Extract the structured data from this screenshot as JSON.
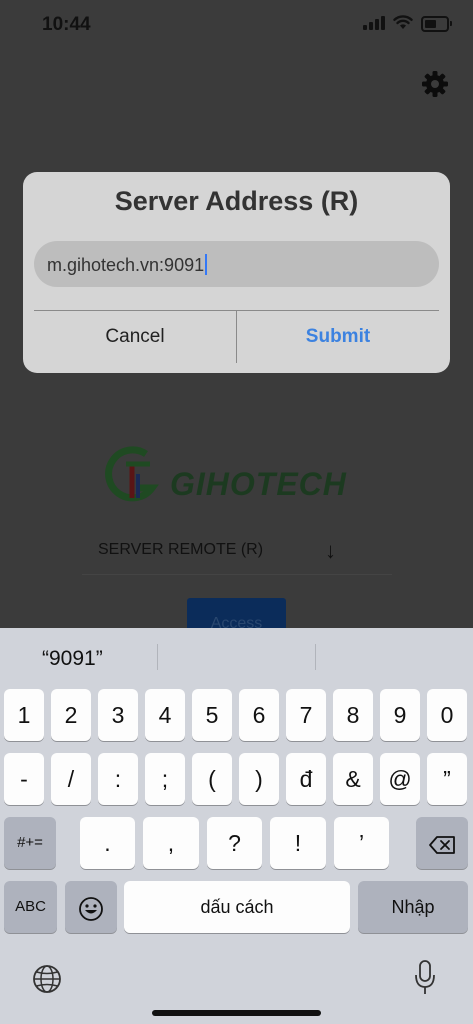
{
  "status_bar": {
    "time": "10:44",
    "battery_level": 0.55
  },
  "app": {
    "logo_text": "GIHOTECH",
    "server_select": {
      "value": "SERVER REMOTE (R)",
      "arrow": "↓"
    },
    "access_button": "Access"
  },
  "dialog": {
    "title": "Server Address (R)",
    "input_value": "m.gihotech.vn:9091",
    "cancel_label": "Cancel",
    "submit_label": "Submit"
  },
  "keyboard": {
    "suggestions": [
      "“9091”",
      "",
      ""
    ],
    "row1": [
      "1",
      "2",
      "3",
      "4",
      "5",
      "6",
      "7",
      "8",
      "9",
      "0"
    ],
    "row2": [
      "-",
      "/",
      ":",
      ";",
      "(",
      ")",
      "đ",
      "&",
      "@",
      "”"
    ],
    "row3": {
      "shift": "#+=",
      "keys": [
        ".",
        ",",
        "?",
        "!",
        "’"
      ]
    },
    "row4": {
      "abc": "ABC",
      "space": "dấu cách",
      "return": "Nhập"
    }
  },
  "colors": {
    "accent": "#3c82e0",
    "dim_background": "#3b3b3b",
    "keyboard_bg": "#d0d3da"
  },
  "icons": [
    "cellular-signal-icon",
    "wifi-icon",
    "battery-icon",
    "settings-gear-icon",
    "gihotech-logo-icon",
    "backspace-icon",
    "emoji-icon",
    "globe-icon",
    "microphone-icon"
  ]
}
